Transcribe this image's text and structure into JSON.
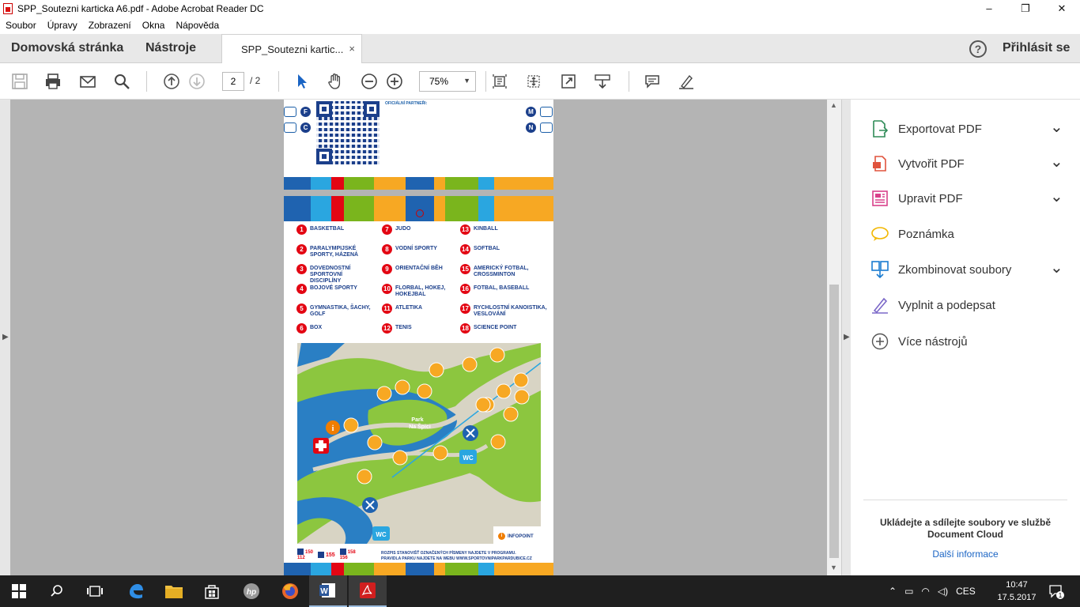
{
  "window": {
    "title": "SPP_Soutezni karticka A6.pdf - Adobe Acrobat Reader DC",
    "controls": [
      "–",
      "❐",
      "✕"
    ]
  },
  "menu": [
    "Soubor",
    "Úpravy",
    "Zobrazení",
    "Okna",
    "Nápověda"
  ],
  "tabs": {
    "home": "Domovská stránka",
    "tools": "Nástroje",
    "document": "SPP_Soutezni kartic...",
    "close": "×",
    "help": "?",
    "signin": "Přihlásit se"
  },
  "toolbar": {
    "page_current": "2",
    "page_total": "/ 2",
    "zoom": "75%",
    "icons": [
      "save-icon",
      "print-icon",
      "mail-icon",
      "search-icon",
      "prev-page-icon",
      "next-page-icon",
      "select-cursor-icon",
      "hand-icon",
      "zoom-out-icon",
      "zoom-in-icon",
      "fit-page-icon",
      "rotate-icon",
      "fullscreen-icon",
      "scroll-mode-icon",
      "comment-icon",
      "sign-icon"
    ]
  },
  "document": {
    "partners_label": "OFICIÁLNÍ PARTNEŘI:",
    "letters_left": [
      "F",
      "C"
    ],
    "letters_right": [
      "M",
      "N"
    ],
    "legend": [
      {
        "num": "1",
        "label": "BASKETBAL"
      },
      {
        "num": "2",
        "label": "PARALYMPIJSKÉ SPORTY, HÁZENÁ"
      },
      {
        "num": "3",
        "label": "DOVEDNOSTNÍ SPORTOVNÍ DISCIPLÍNY"
      },
      {
        "num": "4",
        "label": "BOJOVÉ SPORTY"
      },
      {
        "num": "5",
        "label": "GYMNASTIKA, ŠACHY, GOLF"
      },
      {
        "num": "6",
        "label": "BOX"
      },
      {
        "num": "7",
        "label": "JUDO"
      },
      {
        "num": "8",
        "label": "VODNÍ SPORTY"
      },
      {
        "num": "9",
        "label": "ORIENTAČNÍ BĚH"
      },
      {
        "num": "10",
        "label": "FLORBAL, HOKEJ, HOKEJBAL"
      },
      {
        "num": "11",
        "label": "ATLETIKA"
      },
      {
        "num": "12",
        "label": "TENIS"
      },
      {
        "num": "13",
        "label": "KINBALL"
      },
      {
        "num": "14",
        "label": "SOFTBAL"
      },
      {
        "num": "15",
        "label": "AMERICKÝ FOTBAL, CROSSMINTON"
      },
      {
        "num": "16",
        "label": "FOTBAL, BASEBALL"
      },
      {
        "num": "17",
        "label": "RYCHLOSTNÍ KANOISTIKA, VESLOVÁNÍ"
      },
      {
        "num": "18",
        "label": "SCIENCE POINT"
      }
    ],
    "map_label": "Park\nNa Špici",
    "wc": "WC",
    "infopoint": "INFOPOINT",
    "info_glyph": "i",
    "footer_nums": [
      "150\n112",
      "155",
      "158\n156"
    ],
    "footer_text_1": "ROZPIS STANOVIŠŤ OZNAČENÝCH PÍSMENY NAJDETE V PROGRAMU.",
    "footer_text_2": "PRAVIDLA PARKU NAJDETE NA WEBU WWW.SPORTOVNIPARKPARDUBICE.CZ"
  },
  "right_pane": {
    "items": [
      {
        "label": "Exportovat PDF",
        "icon": "export-pdf-icon",
        "color": "#2e8b57",
        "chevron": true
      },
      {
        "label": "Vytvořit PDF",
        "icon": "create-pdf-icon",
        "color": "#e0533d",
        "chevron": true
      },
      {
        "label": "Upravit PDF",
        "icon": "edit-pdf-icon",
        "color": "#d9418b",
        "chevron": true
      },
      {
        "label": "Poznámka",
        "icon": "comment-icon",
        "color": "#f2b700",
        "chevron": false
      },
      {
        "label": "Zkombinovat soubory",
        "icon": "combine-files-icon",
        "color": "#1a7bd0",
        "chevron": true
      },
      {
        "label": "Vyplnit a podepsat",
        "icon": "fill-sign-icon",
        "color": "#7b68c8",
        "chevron": false
      },
      {
        "label": "Více nástrojů",
        "icon": "more-tools-icon",
        "color": "#555555",
        "chevron": false
      }
    ],
    "chevron": "⌄",
    "cloud_text": "Ukládejte a sdílejte soubory ve službě Document Cloud",
    "more_info": "Další informace"
  },
  "taskbar": {
    "apps": [
      "start-icon",
      "search-icon",
      "task-view-icon",
      "edge-icon",
      "file-explorer-icon",
      "store-icon",
      "hp-icon",
      "firefox-icon",
      "word-icon",
      "acrobat-icon"
    ],
    "tray_up": "⌃",
    "language": "CES",
    "time": "10:47",
    "date": "17.5.2017",
    "notif_count": "1"
  },
  "colors": {
    "stripe": [
      "#1f63b0",
      "#2aa6e0",
      "#e30613",
      "#7ab51d",
      "#f7a823",
      "#1f63b0",
      "#f7a823",
      "#7ab51d",
      "#2aa6e0",
      "#f7a823"
    ],
    "map_water": "#2a7fc4",
    "map_grass": "#8cc63f",
    "map_path": "#d8d4c4",
    "map_pin": "#f7a823"
  }
}
